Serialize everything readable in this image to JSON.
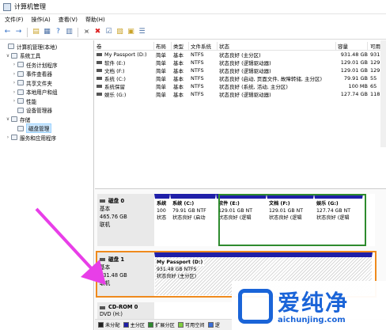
{
  "window": {
    "title": "计算机管理"
  },
  "menu": [
    "文件(F)",
    "操作(A)",
    "查看(V)",
    "帮助(H)"
  ],
  "tree": [
    {
      "label": "计算机管理(本地)",
      "indent": 0,
      "exp": "",
      "icon": "computer-icon"
    },
    {
      "label": "系统工具",
      "indent": 1,
      "exp": "v",
      "icon": "tools-icon"
    },
    {
      "label": "任务计划程序",
      "indent": 2,
      "exp": ">",
      "icon": "clock-icon"
    },
    {
      "label": "事件查看器",
      "indent": 2,
      "exp": ">",
      "icon": "event-log-icon"
    },
    {
      "label": "共享文件夹",
      "indent": 2,
      "exp": ">",
      "icon": "shared-folder-icon"
    },
    {
      "label": "本地用户和组",
      "indent": 2,
      "exp": ">",
      "icon": "users-icon"
    },
    {
      "label": "性能",
      "indent": 2,
      "exp": ">",
      "icon": "performance-icon"
    },
    {
      "label": "设备管理器",
      "indent": 2,
      "exp": "",
      "icon": "device-manager-icon"
    },
    {
      "label": "存储",
      "indent": 1,
      "exp": "v",
      "icon": "storage-icon"
    },
    {
      "label": "磁盘管理",
      "indent": 2,
      "exp": "",
      "icon": "disk-management-icon",
      "selected": true
    },
    {
      "label": "服务和应用程序",
      "indent": 1,
      "exp": ">",
      "icon": "services-icon"
    }
  ],
  "volumes": {
    "headers": [
      "卷",
      "布局",
      "类型",
      "文件系统",
      "状态",
      "容量",
      "可用"
    ],
    "rows": [
      [
        "My Passport (D:)",
        "简单",
        "基本",
        "NTFS",
        "状态良好 (主分区)",
        "931.48 GB",
        "931"
      ],
      [
        "软件 (E:)",
        "简单",
        "基本",
        "NTFS",
        "状态良好 (逻辑驱动器)",
        "129.01 GB",
        "129"
      ],
      [
        "文档 (F:)",
        "简单",
        "基本",
        "NTFS",
        "状态良好 (逻辑驱动器)",
        "129.01 GB",
        "129"
      ],
      [
        "系统 (C:)",
        "简单",
        "基本",
        "NTFS",
        "状态良好 (启动, 页面文件, 故障转储, 主分区)",
        "79.91 GB",
        "55"
      ],
      [
        "系统保留",
        "简单",
        "基本",
        "NTFS",
        "状态良好 (系统, 活动, 主分区)",
        "100 MB",
        "65"
      ],
      [
        "娱乐 (G:)",
        "简单",
        "基本",
        "NTFS",
        "状态良好 (逻辑驱动器)",
        "127.74 GB",
        "118"
      ]
    ]
  },
  "disks": [
    {
      "name": "磁盘 0",
      "type": "基本",
      "size": "465.76 GB",
      "status": "联机",
      "partitions": [
        {
          "name": "系统",
          "size": "100",
          "status": "状态"
        },
        {
          "name": "系统 (C:)",
          "size": "79.91 GB NTF",
          "status": "状态良好 (启动"
        },
        {
          "name": "软件 (E:)",
          "size": "129.01 GB NT",
          "status": "状态良好 (逻辑"
        },
        {
          "name": "文档 (F:)",
          "size": "129.01 GB NT",
          "status": "状态良好 (逻辑"
        },
        {
          "name": "娱乐 (G:)",
          "size": "127.74 GB NT",
          "status": "状态良好 (逻辑"
        }
      ]
    },
    {
      "name": "磁盘 1",
      "type": "基本",
      "size": "931.48 GB",
      "status": "联机",
      "partitions": [
        {
          "name": "My Passport (D:)",
          "size": "931.48 GB NTFS",
          "status": "状态良好 (主分区)"
        }
      ]
    },
    {
      "name": "CD-ROM 0",
      "type": "DVD (H:)"
    }
  ],
  "legend": [
    "未分配",
    "主分区",
    "扩展分区",
    "可用空间",
    "逻"
  ],
  "watermark": {
    "title": "爱纯净",
    "url": "aichunjing.com"
  },
  "colors": {
    "primary_partition": "#1f1fa8",
    "extended_outline": "#2e8b2e",
    "highlight": "#ef8a1d",
    "arrow": "#e83ee8"
  }
}
